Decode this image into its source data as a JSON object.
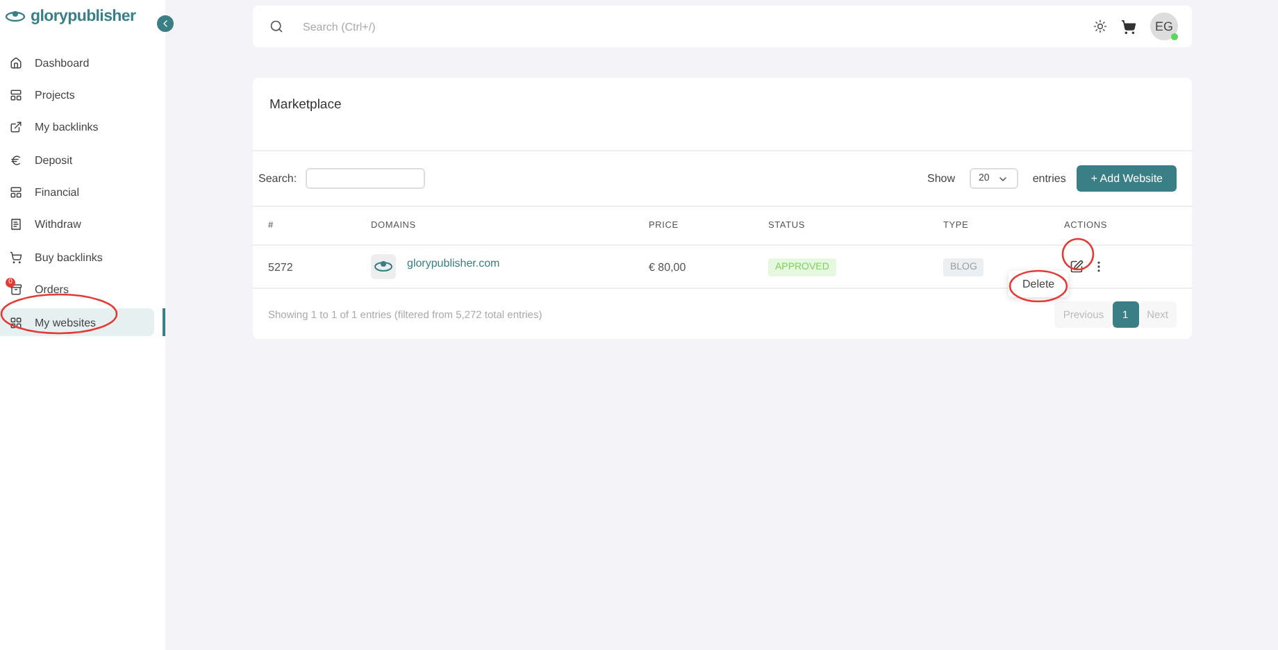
{
  "brand": {
    "name": "glorypublisher"
  },
  "sidebar": {
    "items": [
      {
        "label": "Dashboard",
        "selected": false
      },
      {
        "label": "Projects",
        "selected": false
      },
      {
        "label": "My backlinks",
        "selected": false
      },
      {
        "label": "Deposit",
        "selected": false
      },
      {
        "label": "Financial",
        "selected": false
      },
      {
        "label": "Withdraw",
        "selected": false
      },
      {
        "label": "Buy backlinks",
        "selected": false
      },
      {
        "label": "Orders",
        "selected": false,
        "badge": "0"
      },
      {
        "label": "My websites",
        "selected": true
      }
    ]
  },
  "topbar": {
    "search": {
      "placeholder": "Search (Ctrl+/)"
    },
    "avatar": "EG",
    "online": true
  },
  "card": {
    "title": "Marketplace",
    "search_label": "Search:",
    "show_label": "Show",
    "page_size": "20",
    "entries_label": "entries",
    "add_button": "+ Add Website",
    "columns": [
      "#",
      "DOMAINS",
      "PRICE",
      "STATUS",
      "TYPE",
      "ACTIONS"
    ],
    "rows": [
      {
        "id": "5272",
        "domain": "glorypublisher.com",
        "price": "€ 80,00",
        "status": "APPROVED",
        "type": "BLOG"
      }
    ],
    "info": "Showing 1 to 1 of 1 entries (filtered from 5,272 total entries)",
    "pagination": [
      {
        "label": "Previous",
        "kind": "nav",
        "selected": false,
        "disabled": true
      },
      {
        "label": "1",
        "kind": "page",
        "selected": true,
        "disabled": false
      },
      {
        "label": "Next",
        "kind": "nav",
        "selected": false,
        "disabled": true
      }
    ],
    "menu": {
      "items": [
        "Delete"
      ]
    }
  }
}
